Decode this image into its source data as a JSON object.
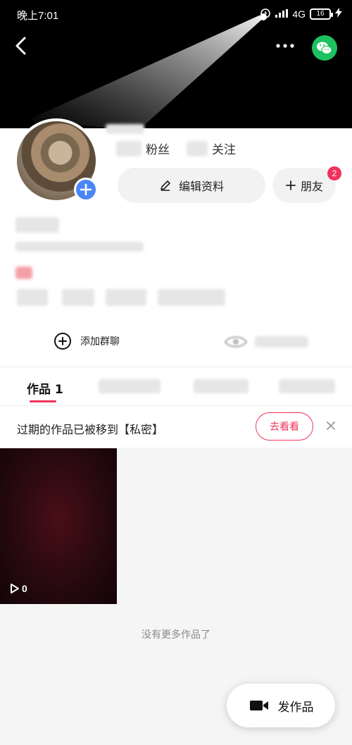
{
  "status_bar": {
    "time": "晚上7:01",
    "network": "4G",
    "battery": "16"
  },
  "profile": {
    "fans_label": "粉丝",
    "following_label": "关注"
  },
  "actions": {
    "edit_label": "编辑资料",
    "friends_label": "朋友",
    "friends_badge": "2"
  },
  "group_chat": {
    "label": "添加群聊"
  },
  "tabs": {
    "active_label": "作品 1"
  },
  "notice": {
    "text": "过期的作品已被移到【私密】",
    "button": "去看看"
  },
  "video": {
    "plays": "0"
  },
  "footer": {
    "no_more": "没有更多作品了",
    "publish_label": "发作品"
  },
  "colors": {
    "accent": "#f0335a",
    "wechat": "#1ec160",
    "avatar_plus": "#4a86f5"
  }
}
